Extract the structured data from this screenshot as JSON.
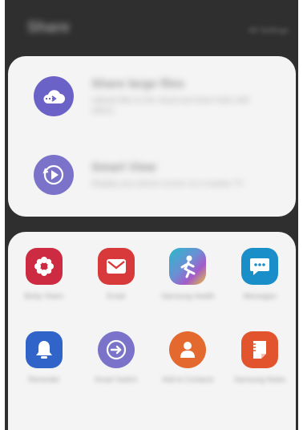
{
  "header": {
    "title": "Share",
    "action": "All Settings"
  },
  "share_options": [
    {
      "title": "Share large files",
      "description": "Upload files to the cloud and share links with others",
      "icon": "cloud-upload-icon",
      "color": "#6b62c7"
    },
    {
      "title": "Smart View",
      "description": "Display your phone screen on a nearby TV",
      "icon": "smart-view-icon",
      "color": "#7b73c9"
    }
  ],
  "apps": [
    {
      "label": "Bixby Vision",
      "icon": "flower-icon",
      "color": "#cc2b42"
    },
    {
      "label": "Email",
      "icon": "envelope-icon",
      "color": "#d8393a"
    },
    {
      "label": "Samsung Health",
      "icon": "health-runner-icon",
      "color": "#6b8fd4"
    },
    {
      "label": "Messages",
      "icon": "chat-bubble-icon",
      "color": "#1a8ec8"
    },
    {
      "label": "Reminder",
      "icon": "bell-icon",
      "color": "#3064c9"
    },
    {
      "label": "Smart Switch",
      "icon": "switch-arrow-icon",
      "color": "#7b73c9"
    },
    {
      "label": "Add to Contacts",
      "icon": "contact-icon",
      "color": "#e3692e"
    },
    {
      "label": "Samsung Notes",
      "icon": "note-icon",
      "color": "#e1542d"
    }
  ]
}
